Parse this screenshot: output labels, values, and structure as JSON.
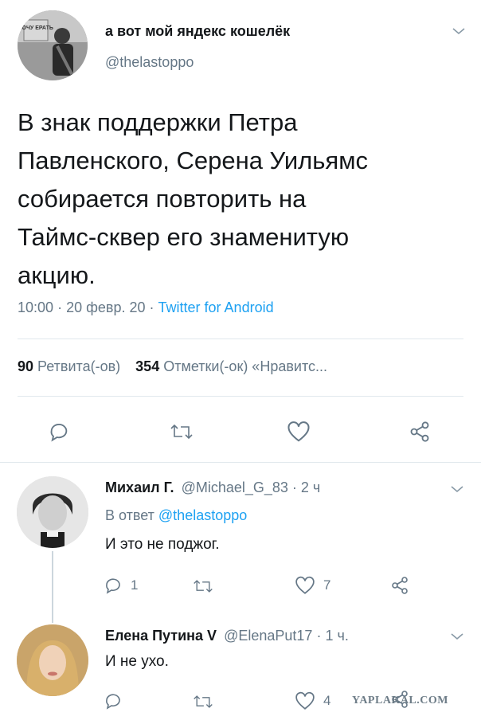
{
  "main_tweet": {
    "display_name": "а вот мой яндекс кошелёк",
    "handle": "@thelastoppo",
    "avatar_sign_text": "ХОЧУ ЕРАТЬ",
    "text_lines": [
      "В знак поддержки Петра",
      "Павленского, Серена Уильямс",
      "собирается повторить на",
      "Таймс-сквер его знаменитую",
      "акцию."
    ],
    "time": "10:00",
    "date": "20 февр. 20",
    "source": "Twitter for Android",
    "retweets_count": "90",
    "retweets_label": "Ретвита(-ов)",
    "likes_count": "354",
    "likes_label": "Отметки(-ок) «Нравитс..."
  },
  "replies": [
    {
      "display_name": "Михаил Г.",
      "handle": "@Michael_G_83",
      "time": "2 ч",
      "reply_to_prefix": "В ответ",
      "reply_to_handle": "@thelastoppo",
      "text": "И это не поджог.",
      "reply_count": "1",
      "retweet_count": "",
      "like_count": "7"
    },
    {
      "display_name": "Елена Путина V",
      "handle": "@ElenaPut17",
      "time": "1 ч.",
      "text": "И не ухо.",
      "reply_count": "",
      "retweet_count": "",
      "like_count": "4"
    }
  ],
  "watermark": "YAPLAKAL.COM",
  "colors": {
    "link": "#1da1f2",
    "muted": "#657786",
    "text": "#14171a",
    "divider": "#e1e8ed"
  }
}
